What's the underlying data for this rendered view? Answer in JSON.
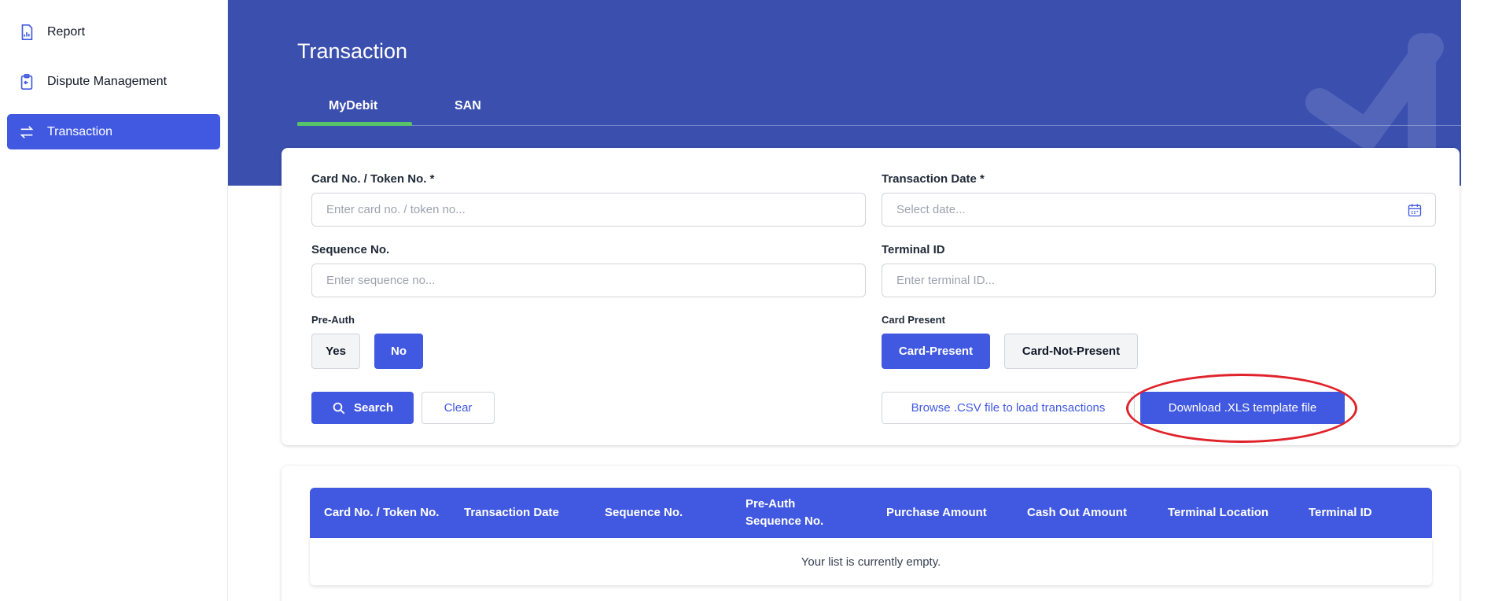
{
  "sidebar": {
    "items": [
      {
        "label": "Report",
        "icon": "report-icon",
        "active": false
      },
      {
        "label": "Dispute Management",
        "icon": "clipboard-icon",
        "active": false
      },
      {
        "label": "Transaction",
        "icon": "swap-arrows-icon",
        "active": true
      }
    ]
  },
  "header": {
    "title": "Transaction",
    "tabs": [
      {
        "label": "MyDebit",
        "active": true
      },
      {
        "label": "SAN",
        "active": false
      }
    ]
  },
  "form": {
    "card_no": {
      "label": "Card No. / Token No. *",
      "placeholder": "Enter card no. / token no...",
      "value": ""
    },
    "transaction_date": {
      "label": "Transaction Date *",
      "placeholder": "Select date...",
      "value": ""
    },
    "sequence_no": {
      "label": "Sequence No.",
      "placeholder": "Enter sequence no...",
      "value": ""
    },
    "terminal_id": {
      "label": "Terminal ID",
      "placeholder": "Enter terminal ID...",
      "value": ""
    },
    "pre_auth": {
      "label": "Pre-Auth",
      "options": [
        "Yes",
        "No"
      ],
      "selected": "No"
    },
    "card_present": {
      "label": "Card Present",
      "options": [
        "Card-Present",
        "Card-Not-Present"
      ],
      "selected": "Card-Present"
    },
    "search_label": "Search",
    "clear_label": "Clear",
    "browse_label": "Browse .CSV file to load transactions",
    "download_label": "Download .XLS template file"
  },
  "table": {
    "columns": [
      "Card No. / Token No.",
      "Transaction Date",
      "Sequence No.",
      "Pre-Auth Sequence No.",
      "Purchase Amount",
      "Cash Out Amount",
      "Terminal Location",
      "Terminal ID"
    ],
    "empty_message": "Your list is currently empty."
  },
  "colors": {
    "brand": "#3a4fae",
    "accent": "#4159e0",
    "tab_indicator": "#58c46a",
    "highlight_ellipse": "#e0222a"
  }
}
